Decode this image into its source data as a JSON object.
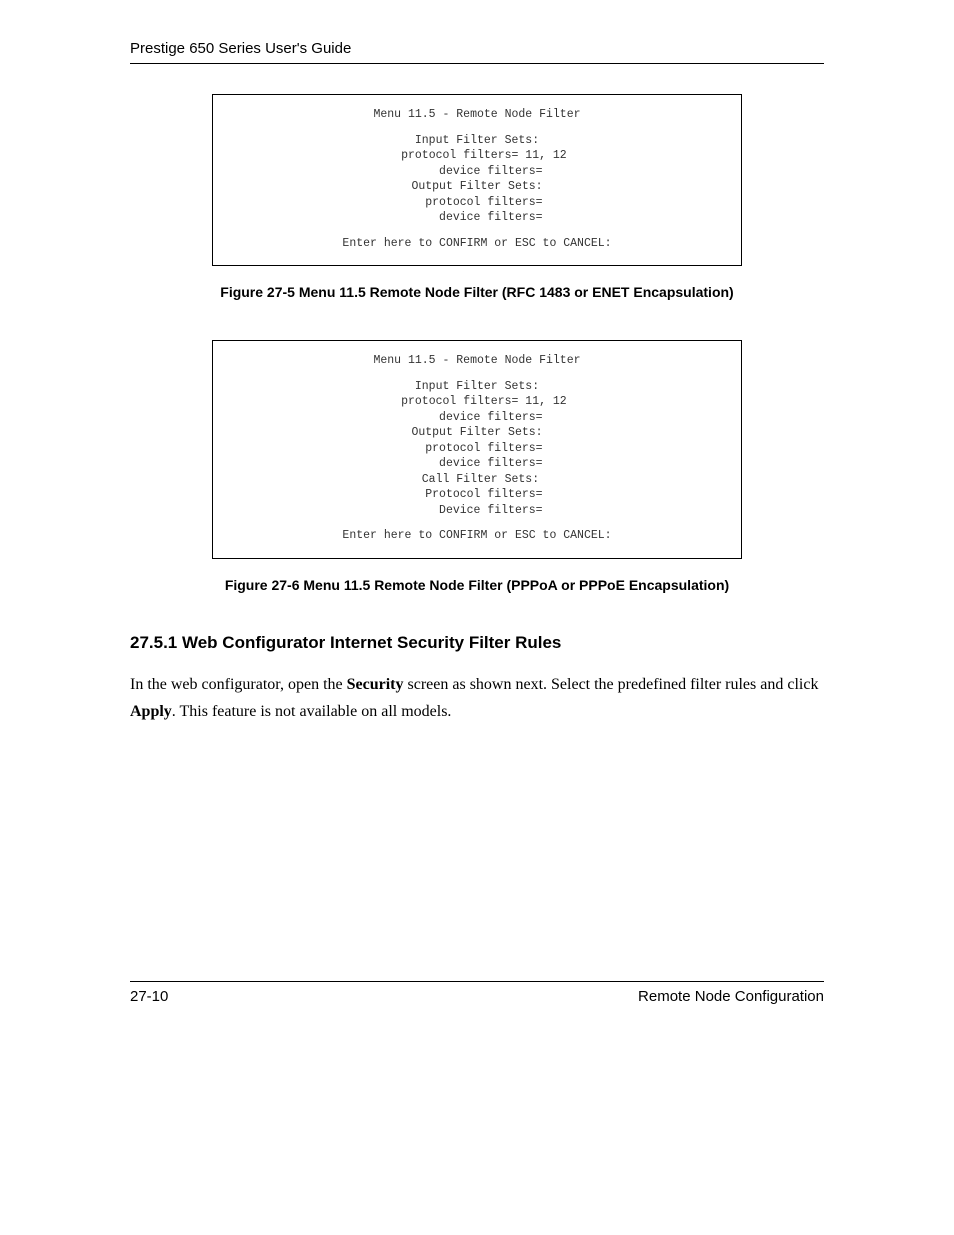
{
  "header": {
    "title": "Prestige 650 Series User's Guide"
  },
  "terminal1": {
    "title": "Menu 11.5 - Remote Node Filter",
    "lines": "Input Filter Sets:\n  protocol filters= 11, 12\n    device filters=\nOutput Filter Sets:\n  protocol filters=\n    device filters=",
    "confirm": "Enter here to CONFIRM or ESC to CANCEL:"
  },
  "caption1": "Figure 27-5 Menu 11.5 Remote Node Filter (RFC 1483 or ENET Encapsulation)",
  "terminal2": {
    "title": "Menu 11.5 - Remote Node Filter",
    "lines": "Input Filter Sets:\n  protocol filters= 11, 12\n    device filters=\nOutput Filter Sets:\n  protocol filters=\n    device filters=\n Call Filter Sets:\n  Protocol filters=\n    Device filters=",
    "confirm": "Enter here to CONFIRM or ESC to CANCEL:"
  },
  "caption2": "Figure 27-6 Menu 11.5 Remote Node Filter (PPPoA or PPPoE Encapsulation)",
  "section": {
    "heading": "27.5.1 Web Configurator Internet Security Filter Rules",
    "p1a": "In the web configurator, open the ",
    "p1b": "Security",
    "p1c": " screen as shown next. Select the predefined filter rules and click ",
    "p1d": "Apply",
    "p1e": ". This feature is not available on all models."
  },
  "footer": {
    "page": "27-10",
    "label": "Remote Node Configuration"
  }
}
